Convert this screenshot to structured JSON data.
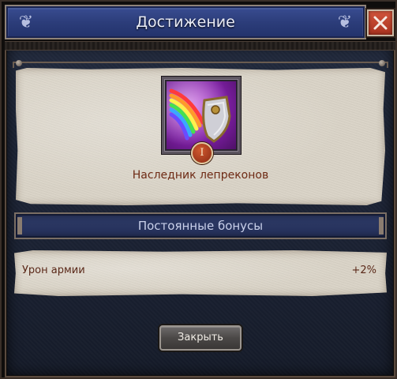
{
  "dialog": {
    "title": "Достижение",
    "close_icon": "close-icon"
  },
  "achievement": {
    "name": "Наследник лепреконов",
    "level": "I",
    "icon": "rainbow-shield-icon"
  },
  "bonuses": {
    "header": "Постоянные бонусы",
    "items": [
      {
        "name": "Урон армии",
        "value": "+2%"
      }
    ]
  },
  "footer": {
    "close_label": "Закрыть"
  },
  "colors": {
    "header_blue": "#2c3d7a",
    "close_red": "#b33a22",
    "parchment": "#d9d3c6",
    "text_brown": "#6e2a14",
    "body_navy": "#1b2233"
  }
}
